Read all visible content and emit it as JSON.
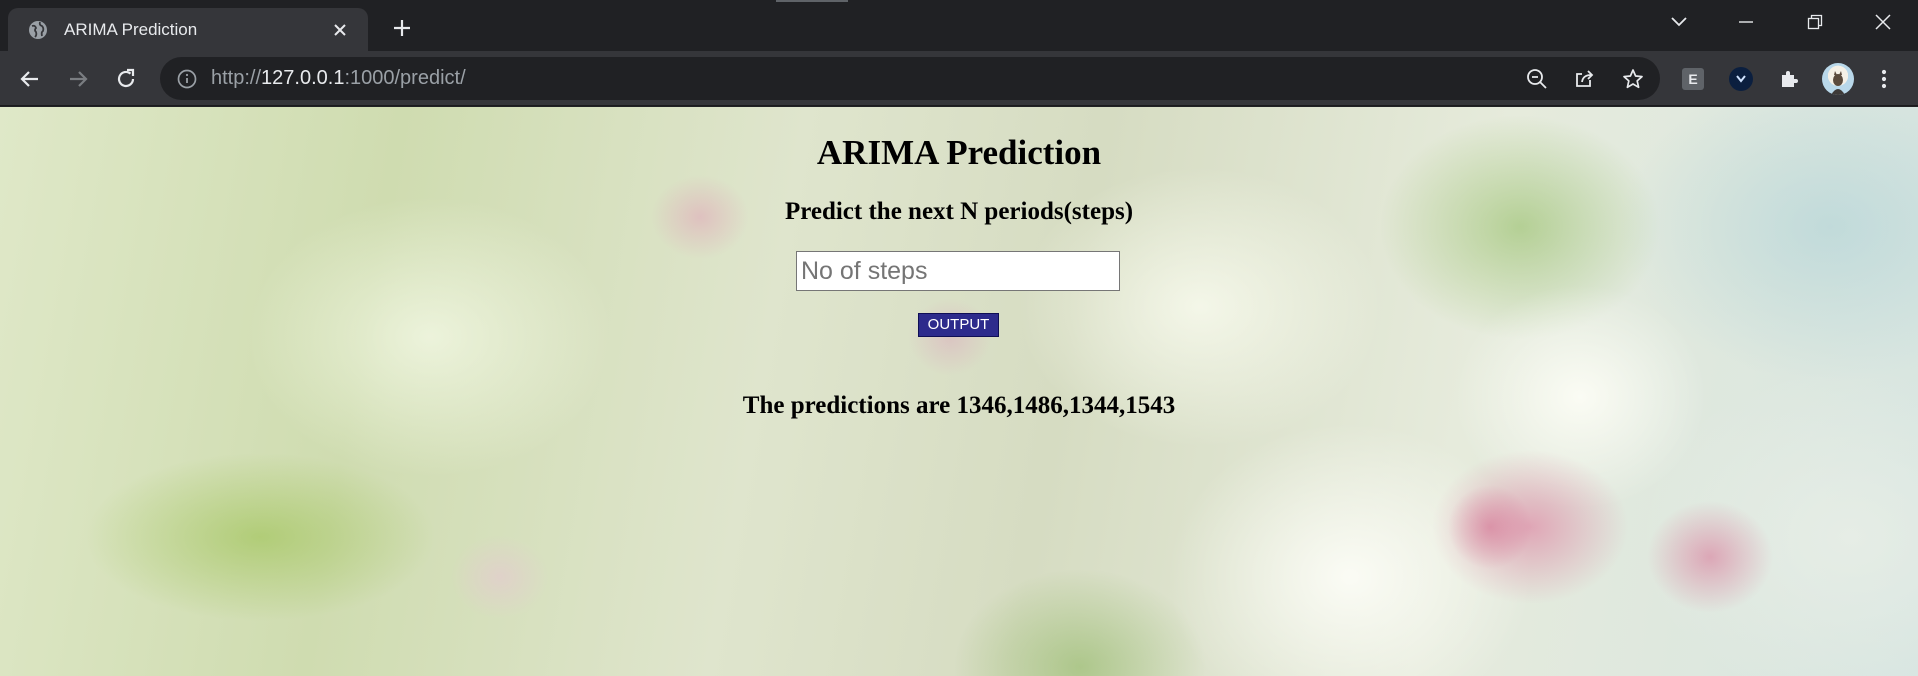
{
  "browser": {
    "tab": {
      "title": "ARIMA Prediction",
      "favicon": "globe-icon"
    },
    "url": {
      "scheme": "http://",
      "host": "127.0.0.1",
      "rest": ":1000/predict/"
    },
    "extensions": [
      "E",
      "V"
    ]
  },
  "page": {
    "title": "ARIMA Prediction",
    "subtitle": "Predict the next N periods(steps)",
    "steps_input": {
      "value": "",
      "placeholder": "No of steps"
    },
    "output_button": "OUTPUT",
    "predictions": "The predictions are 1346,1486,1344,1543"
  },
  "colors": {
    "button_bg": "#2d2b8c",
    "chrome_dark": "#202124",
    "chrome_toolbar": "#35363a"
  }
}
